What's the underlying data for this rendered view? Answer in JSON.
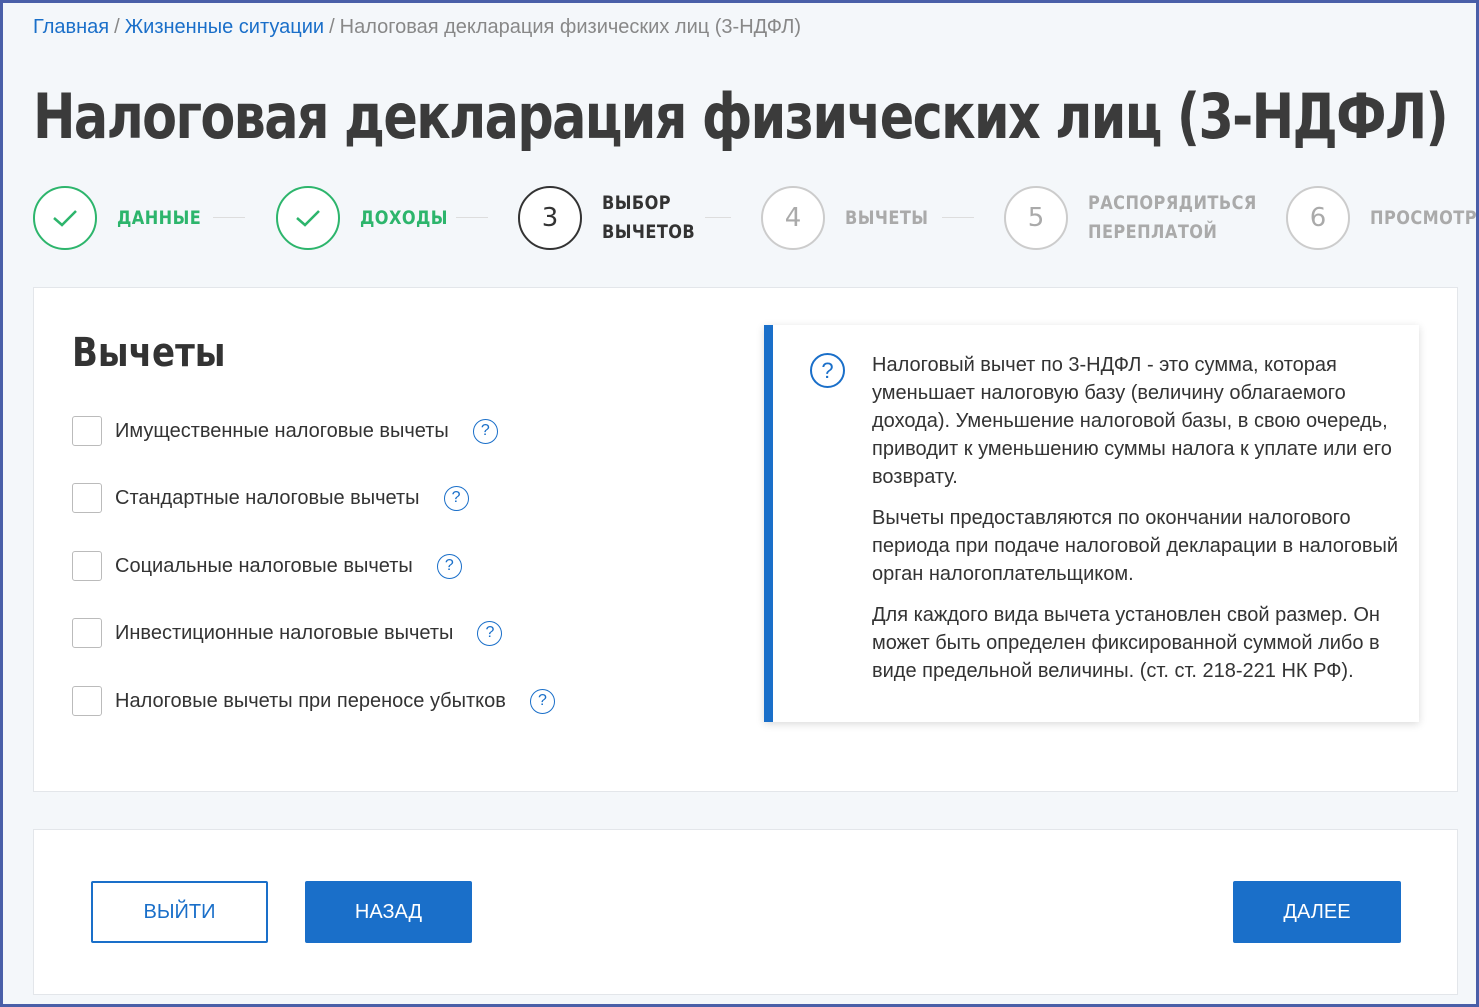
{
  "breadcrumb": {
    "items": [
      "Главная",
      "Жизненные ситуации"
    ],
    "current": "Налоговая декларация физических лиц (3-НДФЛ)",
    "separator": "/"
  },
  "page_title": "Налоговая декларация физических лиц (3-НДФЛ)",
  "stepper": {
    "steps": [
      {
        "marker": "✓",
        "label_line1": "ДАННЫЕ",
        "label_line2": "",
        "state": "done"
      },
      {
        "marker": "✓",
        "label_line1": "ДОХОДЫ",
        "label_line2": "",
        "state": "done"
      },
      {
        "marker": "3",
        "label_line1": "ВЫБОР",
        "label_line2": "ВЫЧЕТОВ",
        "state": "active"
      },
      {
        "marker": "4",
        "label_line1": "ВЫЧЕТЫ",
        "label_line2": "",
        "state": "pending"
      },
      {
        "marker": "5",
        "label_line1": "РАСПОРЯДИТЬСЯ",
        "label_line2": "ПЕРЕПЛАТОЙ",
        "state": "pending"
      },
      {
        "marker": "6",
        "label_line1": "ПРОСМОТР",
        "label_line2": "",
        "state": "pending"
      }
    ]
  },
  "deductions": {
    "title": "Вычеты",
    "options": [
      {
        "label": "Имущественные налоговые вычеты",
        "checked": false
      },
      {
        "label": "Стандартные налоговые вычеты",
        "checked": false
      },
      {
        "label": "Социальные налоговые вычеты",
        "checked": false
      },
      {
        "label": "Инвестиционные налоговые вычеты",
        "checked": false
      },
      {
        "label": "Налоговые вычеты при переносе убытков",
        "checked": false
      }
    ],
    "help_glyph": "?"
  },
  "info": {
    "icon_glyph": "?",
    "paragraphs": [
      "Налоговый вычет по 3-НДФЛ - это сумма, которая уменьшает налоговую базу (величину облагаемого дохода). Уменьшение налоговой базы, в свою очередь, приводит к уменьшению суммы налога к уплате или его возврату.",
      "Вычеты предоставляются по окончании налогового периода при подаче налоговой декларации в налоговый орган налогоплательщиком.",
      "Для каждого вида вычета установлен свой размер. Он может быть определен фиксированной суммой либо в виде предельной величины. (ст. ст. 218-221 НК РФ)."
    ]
  },
  "actions": {
    "exit_label": "ВЫЙТИ",
    "back_label": "НАЗАД",
    "next_label": "ДАЛЕЕ"
  },
  "colors": {
    "accent": "#1a6fc9",
    "done": "#2db56c",
    "frame": "#4a5fa8"
  }
}
